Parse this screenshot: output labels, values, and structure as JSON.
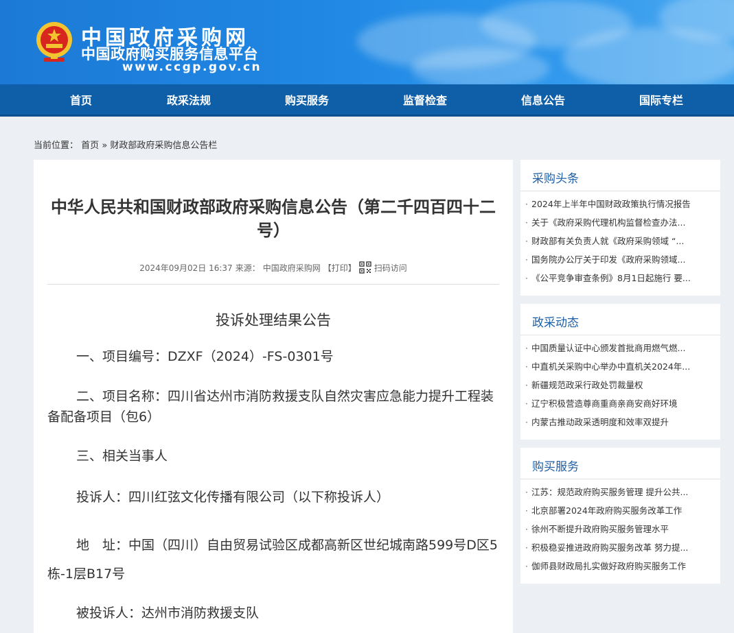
{
  "header": {
    "site_name": "中国政府采购网",
    "platform_name": "中国政府购买服务信息平台",
    "url_text": "www.ccgp.gov.cn",
    "emblem_icon": "national-emblem-icon"
  },
  "nav": {
    "items": [
      "首页",
      "政采法规",
      "购买服务",
      "监督检查",
      "信息公告",
      "国际专栏"
    ]
  },
  "breadcrumb": {
    "prefix": "当前位置：",
    "home": "首页",
    "separator": "»",
    "current": "财政部政府采购信息公告栏"
  },
  "article": {
    "title": "中华人民共和国财政部政府采购信息公告（第二千四百四十二号）",
    "date": "2024年09月02日 16:37",
    "source_label": "来源：",
    "source": "中国政府采购网",
    "print_label": "【打印】",
    "qr_label": "扫码访问",
    "qr_icon": "qr-code-icon",
    "body_title": "投诉处理结果公告",
    "paragraphs": [
      "一、项目编号：DZXF（2024）-FS-0301号",
      "二、项目名称：四川省达州市消防救援支队自然灾害应急能力提升工程装备配备项目（包6）",
      "三、相关当事人",
      "投诉人：四川红弦文化传播有限公司（以下称投诉人）",
      "地　址：中国（四川）自由贸易试验区成都高新区世纪城南路599号D区5栋-1层B17号",
      "被投诉人：达州市消防救援支队"
    ]
  },
  "sidebar": {
    "sections": [
      {
        "title": "采购头条",
        "items": [
          "2024年上半年中国财政政策执行情况报告",
          "关于《政府采购代理机构监督检查办法...",
          "财政部有关负责人就《政府采购领域 “...",
          "国务院办公厅关于印发《政府采购领域...",
          "《公平竞争审查条例》8月1日起施行 要..."
        ]
      },
      {
        "title": "政采动态",
        "items": [
          "中国质量认证中心颁发首批商用燃气燃...",
          "中直机关采购中心举办中直机关2024年...",
          "新疆规范政采行政处罚裁量权",
          "辽宁积极营造尊商重商亲商安商好环境",
          "内蒙古推动政采透明度和效率双提升"
        ]
      },
      {
        "title": "购买服务",
        "items": [
          "江苏：规范政府购买服务管理 提升公共...",
          "北京部署2024年政府购买服务改革工作",
          "徐州不断提升政府购买服务管理水平",
          "积极稳妥推进政府购买服务改革 努力提...",
          "伽师县财政局扎实做好政府购买服务工作"
        ]
      }
    ]
  }
}
